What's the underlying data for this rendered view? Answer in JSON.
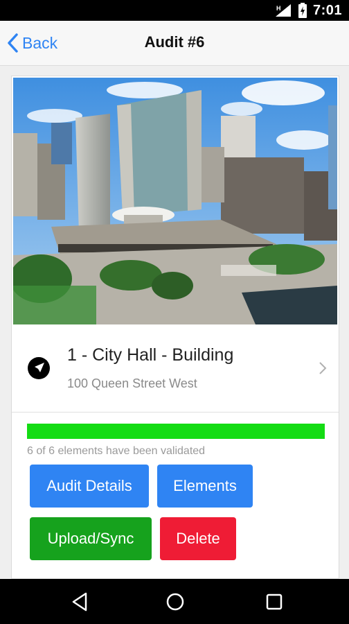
{
  "status_bar": {
    "time": "7:01"
  },
  "nav": {
    "back_label": "Back",
    "title": "Audit #6"
  },
  "location": {
    "name": "1 - City Hall - Building",
    "address": "100 Queen Street West"
  },
  "progress": {
    "fraction": 1.0,
    "text": "6 of 6 elements have been validated"
  },
  "actions": {
    "audit_details": "Audit Details",
    "elements": "Elements",
    "upload_sync": "Upload/Sync",
    "delete": "Delete"
  },
  "colors": {
    "accent_blue": "#2f84f3",
    "progress_green": "#14dc14",
    "upload_green": "#16a21d",
    "delete_red": "#ef1c35"
  },
  "icons": {
    "location": "navigation-arrow-icon",
    "chevron": "chevron-right-icon"
  }
}
